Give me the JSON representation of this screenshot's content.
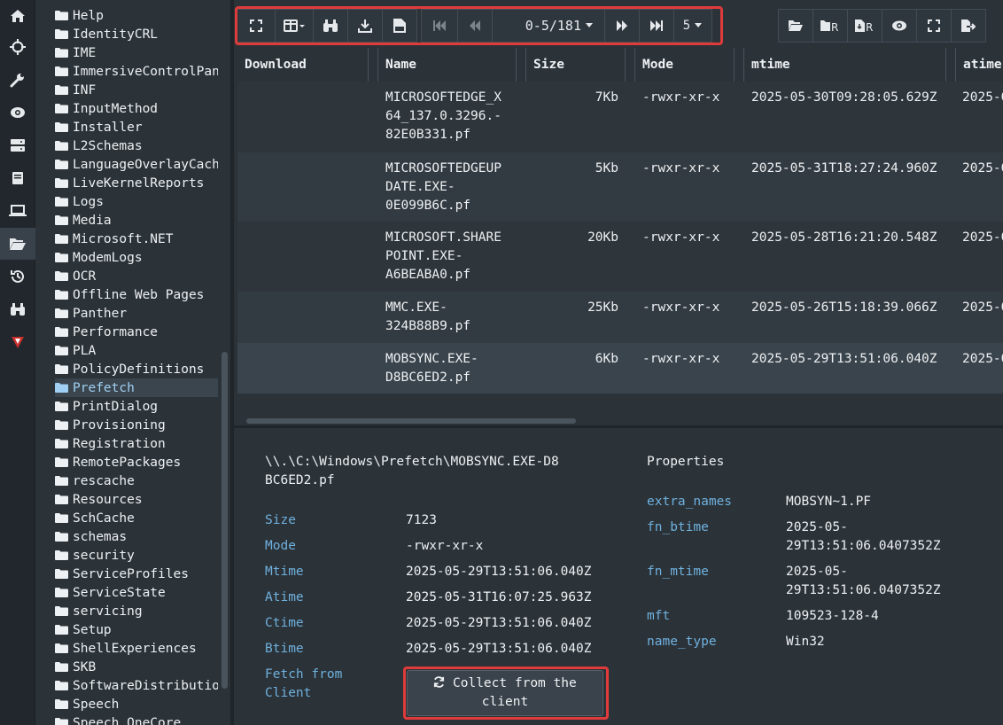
{
  "sidebar_icons": [
    "home-icon",
    "crosshair-icon",
    "wrench-icon",
    "eye-icon",
    "server-icon",
    "book-icon",
    "laptop-icon",
    "folder-open-icon",
    "history-icon",
    "binoculars-icon",
    "velociraptor-icon"
  ],
  "tree": {
    "items": [
      "Help",
      "IdentityCRL",
      "IME",
      "ImmersiveControlPanel",
      "INF",
      "InputMethod",
      "Installer",
      "L2Schemas",
      "LanguageOverlayCache",
      "LiveKernelReports",
      "Logs",
      "Media",
      "Microsoft.NET",
      "ModemLogs",
      "OCR",
      "Offline Web Pages",
      "Panther",
      "Performance",
      "PLA",
      "PolicyDefinitions",
      "Prefetch",
      "PrintDialog",
      "Provisioning",
      "Registration",
      "RemotePackages",
      "rescache",
      "Resources",
      "SchCache",
      "schemas",
      "security",
      "ServiceProfiles",
      "ServiceState",
      "servicing",
      "Setup",
      "ShellExperiences",
      "SKB",
      "SoftwareDistribution",
      "Speech",
      "Speech_OneCore"
    ],
    "selected": "Prefetch"
  },
  "toolbar": {
    "pager": "0-5/181",
    "page_size": "5"
  },
  "table": {
    "columns": [
      "Download",
      "Name",
      "Size",
      "Mode",
      "mtime",
      "atime"
    ],
    "rows": [
      {
        "name": [
          "MICROSOFTEDGE_X",
          "64_137.0.3296.-",
          "82E0B331.pf"
        ],
        "size": "7Kb",
        "mode": "-rwxr-xr-x",
        "mtime": "2025-05-30T09:28:05.629Z",
        "atime": "2025-0"
      },
      {
        "name": [
          "MICROSOFTEDGEUP",
          "DATE.EXE-",
          "0E099B6C.pf"
        ],
        "size": "5Kb",
        "mode": "-rwxr-xr-x",
        "mtime": "2025-05-31T18:27:24.960Z",
        "atime": "2025-0"
      },
      {
        "name": [
          "MICROSOFT.SHARE",
          "POINT.EXE-",
          "A6BEABA0.pf"
        ],
        "size": "20Kb",
        "mode": "-rwxr-xr-x",
        "mtime": "2025-05-28T16:21:20.548Z",
        "atime": "2025-0"
      },
      {
        "name": [
          "MMC.EXE-",
          "324B88B9.pf"
        ],
        "size": "25Kb",
        "mode": "-rwxr-xr-x",
        "mtime": "2025-05-26T15:18:39.066Z",
        "atime": "2025-0"
      },
      {
        "name": [
          "MOBSYNC.EXE-",
          "D8BC6ED2.pf"
        ],
        "size": "6Kb",
        "mode": "-rwxr-xr-x",
        "mtime": "2025-05-29T13:51:06.040Z",
        "atime": "2025-0"
      }
    ]
  },
  "details": {
    "path": "\\\\.\\C:\\Windows\\Prefetch\\MOBSYNC.EXE-D8BC6ED2.pf",
    "fields": [
      {
        "label": "Size",
        "value": "7123"
      },
      {
        "label": "Mode",
        "value": "-rwxr-xr-x"
      },
      {
        "label": "Mtime",
        "value": "2025-05-29T13:51:06.040Z"
      },
      {
        "label": "Atime",
        "value": "2025-05-31T16:07:25.963Z"
      },
      {
        "label": "Ctime",
        "value": "2025-05-29T13:51:06.040Z"
      },
      {
        "label": "Btime",
        "value": "2025-05-29T13:51:06.040Z"
      }
    ],
    "fetch_label": [
      "Fetch from",
      "Client"
    ],
    "collect_label": [
      "Collect from the",
      "client"
    ],
    "properties_title": "Properties",
    "properties": [
      {
        "label": "extra_names",
        "value": [
          "MOBSYN~1.PF"
        ]
      },
      {
        "label": "fn_btime",
        "value": [
          "2025-05-",
          "29T13:51:06.0407352Z"
        ]
      },
      {
        "label": "fn_mtime",
        "value": [
          "2025-05-",
          "29T13:51:06.0407352Z"
        ]
      },
      {
        "label": "mft",
        "value": [
          "109523-128-4"
        ]
      },
      {
        "label": "name_type",
        "value": [
          "Win32"
        ]
      }
    ]
  },
  "colors": {
    "accent_label": "#6fb1de",
    "highlight_box": "#e03b3b",
    "selected_tree": "#9fd0f3"
  }
}
